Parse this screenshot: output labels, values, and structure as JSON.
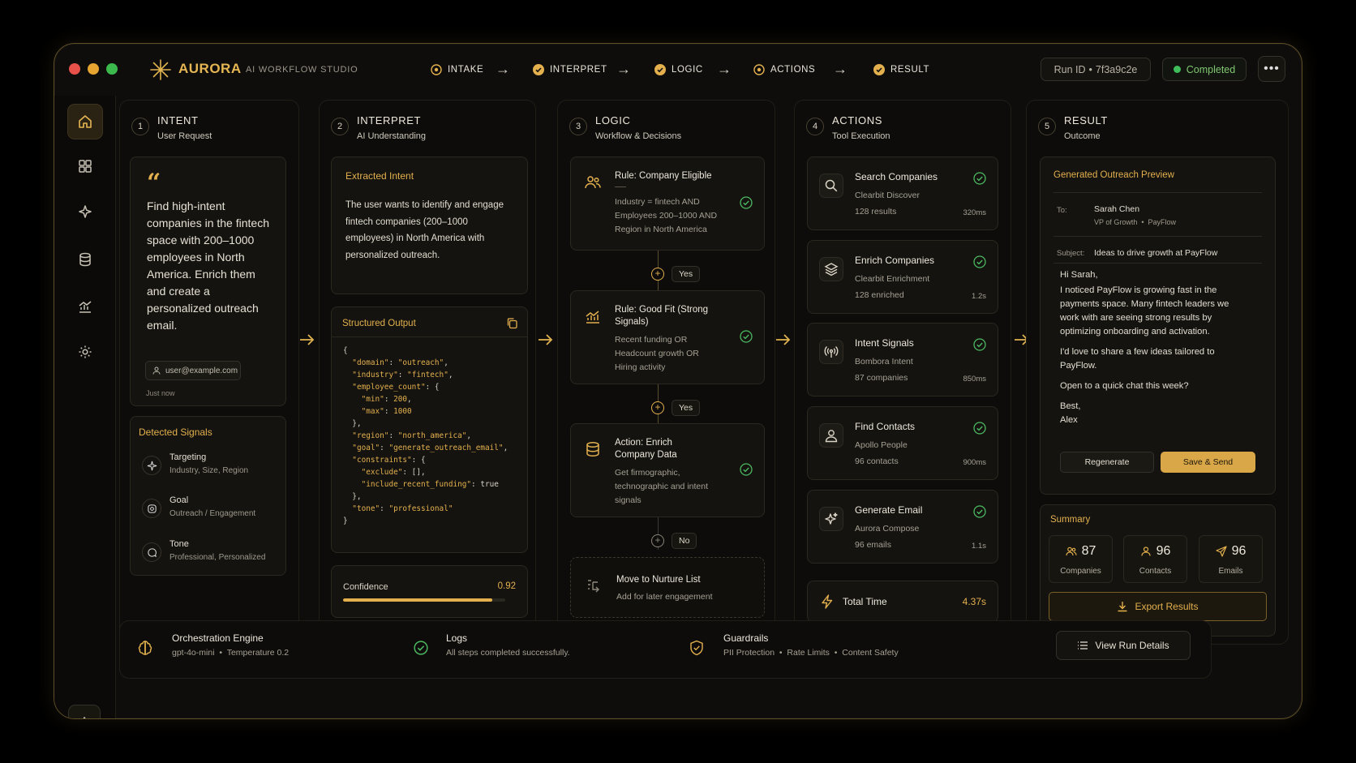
{
  "app": {
    "name": "AURORA",
    "subtitle": "AI WORKFLOW STUDIO"
  },
  "pipeline": [
    "INTAKE",
    "INTERPRET",
    "LOGIC",
    "ACTIONS",
    "RESULT"
  ],
  "run": {
    "id_label": "Run ID",
    "id_value": "7f3a9c2e",
    "status": "Completed"
  },
  "colors": {
    "accent": "#e3b04d",
    "success": "#3ebd5a",
    "background": "#0e0d0b"
  },
  "sidebar": {
    "items": [
      "home-icon",
      "grid-icon",
      "sparkle-icon",
      "database-icon",
      "chart-icon",
      "gear-icon"
    ],
    "avatar": "A"
  },
  "columns": [
    {
      "num": "1",
      "title": "INTENT",
      "sub": "User Request"
    },
    {
      "num": "2",
      "title": "INTERPRET",
      "sub": "AI Understanding"
    },
    {
      "num": "3",
      "title": "LOGIC",
      "sub": "Workflow & Decisions"
    },
    {
      "num": "4",
      "title": "ACTIONS",
      "sub": "Tool Execution"
    },
    {
      "num": "5",
      "title": "RESULT",
      "sub": "Outcome"
    }
  ],
  "intent": {
    "request": "Find high-intent companies in the fintech space with 200–1000 employees in North America. Enrich them and create a personalized outreach email.",
    "user": "user@example.com",
    "time": "Just now",
    "signals_title": "Detected Signals",
    "signals": [
      {
        "label": "Targeting",
        "value": "Industry, Size, Region"
      },
      {
        "label": "Goal",
        "value": "Outreach / Engagement"
      },
      {
        "label": "Tone",
        "value": "Professional, Personalized"
      }
    ]
  },
  "interpret": {
    "extracted_title": "Extracted Intent",
    "extracted_text": "The user wants to identify and engage fintech companies (200–1000 employees) in North America with personalized outreach.",
    "structured_title": "Structured Output",
    "confidence_label": "Confidence",
    "confidence_value": "0.92",
    "confidence": 0.92
  },
  "logic": {
    "cards": [
      {
        "title": "Rule: Company Eligible",
        "desc": "Industry = fintech AND Employees 200–1000 AND Region in North America"
      },
      {
        "title": "Rule: Good Fit (Strong Signals)",
        "desc": "Recent funding OR Headcount growth OR Hiring activity"
      },
      {
        "title": "Action: Enrich Company Data",
        "desc": "Get firmographic, technographic and intent signals"
      }
    ],
    "branches": [
      "Yes",
      "Yes",
      "No"
    ],
    "nurture": {
      "title": "Move to Nurture List",
      "desc": "Add for later engagement"
    }
  },
  "actions": {
    "items": [
      {
        "title": "Search Companies",
        "source": "Clearbit Discover",
        "count": "128 results",
        "duration": "320ms"
      },
      {
        "title": "Enrich Companies",
        "source": "Clearbit Enrichment",
        "count": "128 enriched",
        "duration": "1.2s"
      },
      {
        "title": "Intent Signals",
        "source": "Bombora Intent",
        "count": "87 companies",
        "duration": "850ms"
      },
      {
        "title": "Find Contacts",
        "source": "Apollo People",
        "count": "96 contacts",
        "duration": "900ms"
      },
      {
        "title": "Generate Email",
        "source": "Aurora Compose",
        "count": "96 emails",
        "duration": "1.1s"
      }
    ],
    "total_label": "Total Time",
    "total_value": "4.37s"
  },
  "result": {
    "preview_title": "Generated Outreach Preview",
    "to_label": "To:",
    "to_name": "Sarah Chen",
    "to_role": "VP of Growth",
    "to_company": "PayFlow",
    "subject_label": "Subject:",
    "subject": "Ideas to drive growth at PayFlow",
    "body": [
      "Hi Sarah,",
      "I noticed PayFlow is growing fast in the payments space. Many fintech leaders we work with are seeing strong results by optimizing onboarding and activation.",
      "I'd love to share a few ideas tailored to PayFlow.",
      "Open to a quick chat this week?",
      "Best,",
      "Alex"
    ],
    "regenerate": "Regenerate",
    "save_send": "Save & Send",
    "summary_title": "Summary",
    "stats": [
      {
        "value": "87",
        "label": "Companies"
      },
      {
        "value": "96",
        "label": "Contacts"
      },
      {
        "value": "96",
        "label": "Emails"
      }
    ],
    "export": "Export Results"
  },
  "footer": {
    "engine_title": "Orchestration Engine",
    "engine_model": "gpt-4o-mini",
    "engine_temp": "Temperature 0.2",
    "logs_title": "Logs",
    "logs_sub": "All steps completed successfully.",
    "guard_title": "Guardrails",
    "guard_items": [
      "PII Protection",
      "Rate Limits",
      "Content Safety"
    ],
    "view_run": "View Run Details"
  }
}
